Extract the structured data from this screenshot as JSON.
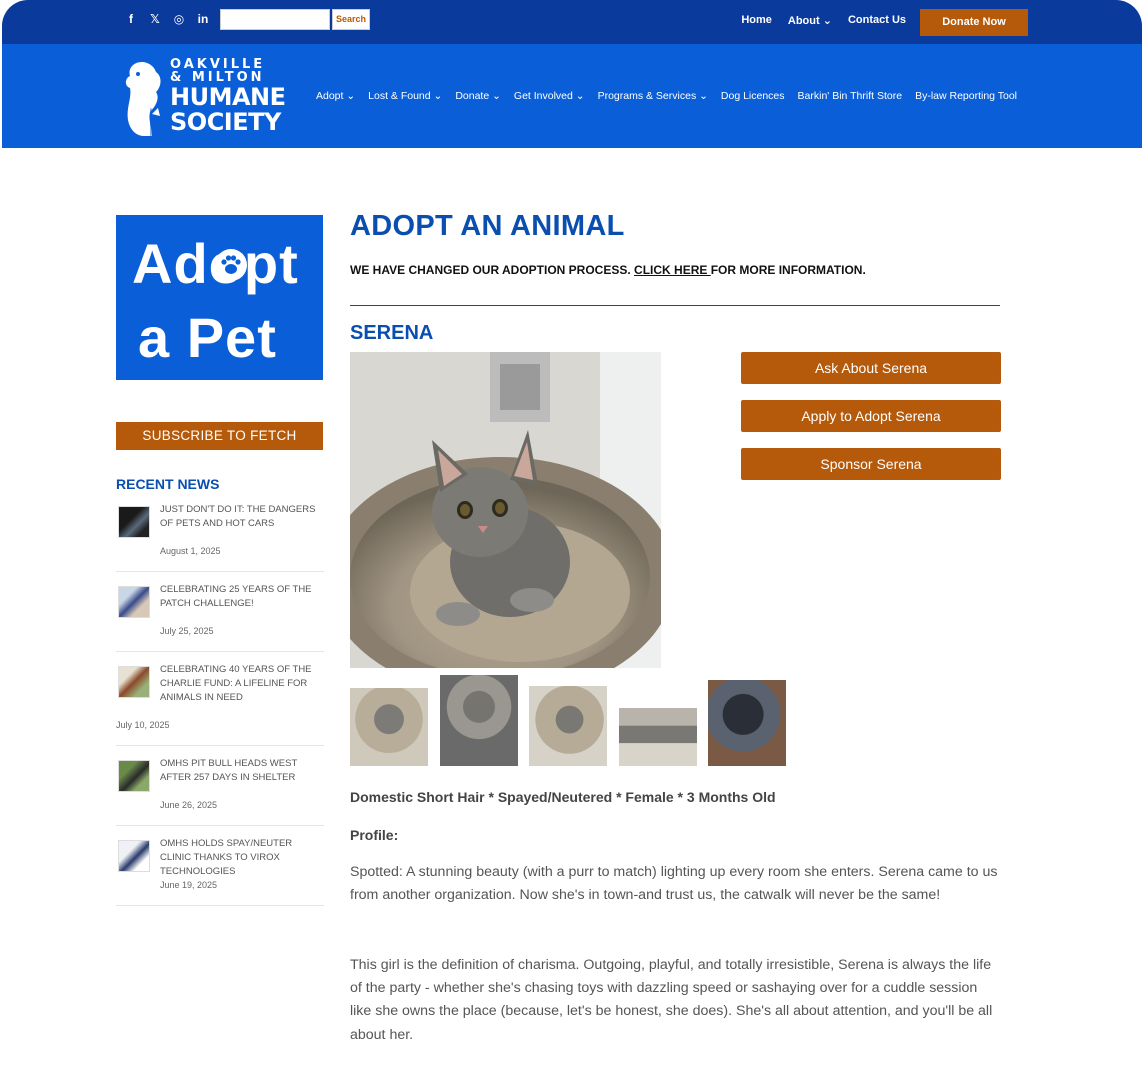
{
  "topbar": {
    "social": [
      {
        "icon": "facebook-icon",
        "glyph": "f"
      },
      {
        "icon": "x-icon",
        "glyph": "𝕏"
      },
      {
        "icon": "instagram-icon",
        "glyph": "◎"
      },
      {
        "icon": "linkedin-icon",
        "glyph": "in"
      }
    ],
    "search_value": "",
    "search_label": "Search",
    "nav": [
      {
        "label": "Home"
      },
      {
        "label": "About ⌄"
      },
      {
        "label": "Contact Us"
      }
    ],
    "donate_label": "Donate Now"
  },
  "logo": {
    "line1": "OAKVILLE",
    "line2": "& MILTON",
    "line3": "HUMANE",
    "line4": "SOCIETY"
  },
  "main_nav": [
    {
      "label": "Adopt ⌄"
    },
    {
      "label": "Lost & Found ⌄"
    },
    {
      "label": "Donate ⌄"
    },
    {
      "label": "Get Involved ⌄"
    },
    {
      "label": "Programs & Services ⌄"
    },
    {
      "label": "Dog Licences"
    },
    {
      "label": "Barkin' Bin Thrift Store"
    },
    {
      "label": "By-law Reporting Tool"
    }
  ],
  "sidebar": {
    "banner_line1": "Adopt",
    "banner_line2": "a  Pet",
    "subscribe_label": "SUBSCRIBE TO FETCH",
    "recent_news_title": "RECENT NEWS",
    "news": [
      {
        "title": "JUST DON'T DO IT: THE DANGERS OF PETS AND HOT CARS",
        "date": "August 1, 2025"
      },
      {
        "title": "CELEBRATING 25 YEARS OF THE PATCH CHALLENGE!",
        "date": "July 25, 2025"
      },
      {
        "title": "CELEBRATING 40 YEARS OF THE CHARLIE FUND: A LIFELINE FOR ANIMALS IN NEED",
        "date": "July 10, 2025"
      },
      {
        "title": "OMHS PIT BULL HEADS WEST AFTER 257 DAYS IN SHELTER",
        "date": "June 26, 2025"
      },
      {
        "title": "OMHS HOLDS SPAY/NEUTER CLINIC THANKS TO VIROX TECHNOLOGIES",
        "date": "June 19, 2025"
      }
    ]
  },
  "main": {
    "page_title": "ADOPT AN ANIMAL",
    "notice_before": "WE HAVE CHANGED OUR ADOPTION PROCESS. ",
    "notice_link": "CLICK HERE ",
    "notice_after": "FOR MORE INFORMATION.",
    "pet_name": "SERENA",
    "buttons": [
      "Ask About Serena",
      "Apply to Adopt Serena",
      "Sponsor Serena"
    ],
    "facts": "Domestic Short Hair * Spayed/Neutered * Female * 3 Months Old",
    "profile_label": "Profile:",
    "paragraph1": "Spotted: A stunning beauty (with a purr to match) lighting up every room she enters. Serena came to us from another organization. Now she's in town-and trust us, the catwalk will never be the same!",
    "paragraph2": "This girl is the definition of charisma. Outgoing, playful, and totally irresistible, Serena is always the life of the party - whether she's chasing toys with dazzling speed or sashaying over for a cuddle session like she owns the place (because, let's be honest, she does). She's all about attention, and you'll be all about her."
  },
  "colors": {
    "topbar": "#0a3a9c",
    "header": "#0a5fd8",
    "accent_orange": "#b5590a",
    "heading_blue": "#0a4fb0"
  }
}
